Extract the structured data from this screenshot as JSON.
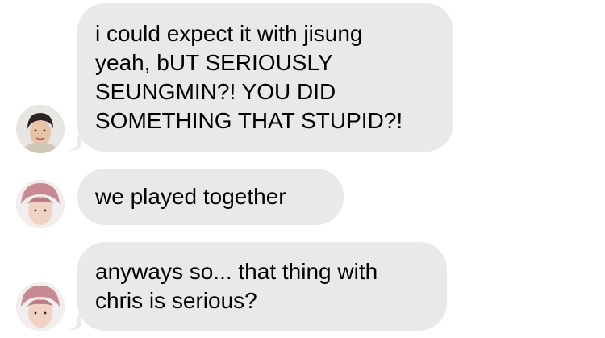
{
  "conversation": {
    "messages": [
      {
        "text": "i could expect it with jisung\nyeah, bUT SERIOUSLY\nSEUNGMIN?! YOU DID\nSOMETHING THAT STUPID?!",
        "avatar_icon": "contact-photo-icon"
      },
      {
        "text": "we played together",
        "avatar_icon": "contact-photo-icon"
      },
      {
        "text": "anyways so... that thing with\nchris is serious?",
        "avatar_icon": "contact-photo-icon"
      }
    ]
  },
  "colors": {
    "background": "#ffffff",
    "bubble": "#e9e9eb",
    "text": "#000000"
  }
}
